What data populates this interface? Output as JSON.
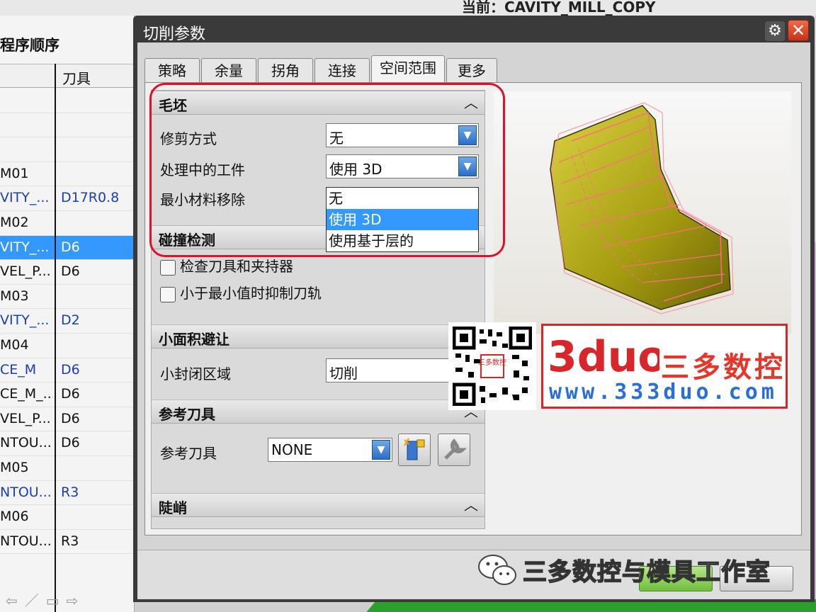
{
  "top": {
    "current_label": "当前：CAVITY_MILL_COPY"
  },
  "navigator": {
    "title": "程序顺序",
    "col_tool": "刀具",
    "rows": [
      {
        "name": "",
        "tool": ""
      },
      {
        "name": "",
        "tool": ""
      },
      {
        "name": "",
        "tool": ""
      },
      {
        "name": "M01",
        "tool": ""
      },
      {
        "name": "VITY_...",
        "tool": "D17R0.8"
      },
      {
        "name": "M02",
        "tool": ""
      },
      {
        "name": "VITY_...",
        "tool": "D6"
      },
      {
        "name": "VEL_P...",
        "tool": "D6"
      },
      {
        "name": "M03",
        "tool": ""
      },
      {
        "name": "VITY_...",
        "tool": "D2"
      },
      {
        "name": "M04",
        "tool": ""
      },
      {
        "name": "CE_M",
        "tool": "D6"
      },
      {
        "name": "CE_M_...",
        "tool": "D6"
      },
      {
        "name": "VEL_P...",
        "tool": "D6"
      },
      {
        "name": "NTOU...",
        "tool": "D6"
      },
      {
        "name": "M05",
        "tool": ""
      },
      {
        "name": "NTOU...",
        "tool": "R3"
      },
      {
        "name": "M06",
        "tool": ""
      },
      {
        "name": "NTOU...",
        "tool": "R3"
      }
    ]
  },
  "dialog": {
    "title": "切削参数",
    "tabs": [
      "策略",
      "余量",
      "拐角",
      "连接",
      "空间范围",
      "更多"
    ],
    "active_tab": "空间范围",
    "blank": {
      "header": "毛坯",
      "trim_label": "修剪方式",
      "trim_value": "无",
      "ipw_label": "处理中的工件",
      "ipw_value": "使用 3D",
      "min_removal_label": "最小材料移除",
      "ipw_options": [
        "无",
        "使用 3D",
        "使用基于层的"
      ],
      "ipw_selected": "使用 3D"
    },
    "collision": {
      "header": "碰撞检测",
      "check_holder": "检查刀具和夹持器",
      "suppress": "小于最小值时抑制刀轨"
    },
    "small_area": {
      "header": "小面积避让",
      "label": "小封闭区域",
      "value": "切削"
    },
    "ref_tool": {
      "header": "参考刀具",
      "label": "参考刀具",
      "value": "NONE"
    },
    "steep": {
      "header": "陡峭"
    }
  },
  "watermark": {
    "qr_text": "三多数控",
    "brand_cn": "三多数控",
    "brand_logo": "3duo",
    "brand_url": "www.333duo.com",
    "wechat": "三多数控与模具工作室"
  },
  "colors": {
    "selection": "#3399ff",
    "dialog_frame": "#3a3a3a",
    "highlight_outline": "#e0102a",
    "part_fill": "#b7b020",
    "wire": "#ff6d7c"
  }
}
